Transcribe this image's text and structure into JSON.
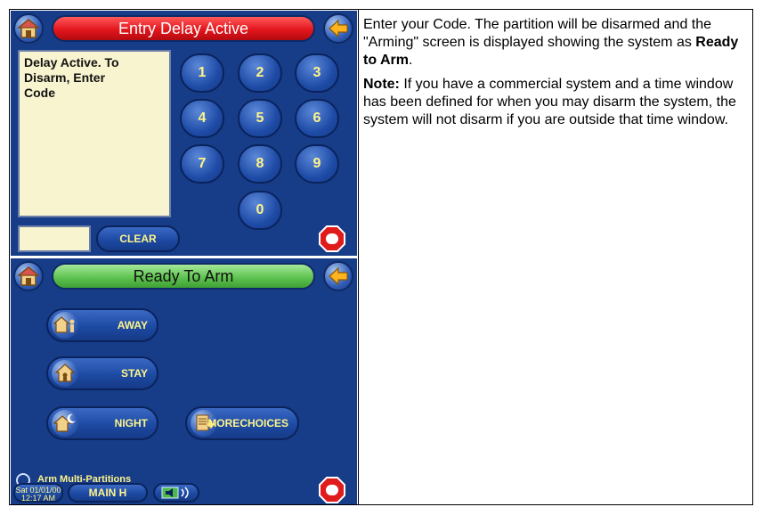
{
  "top_panel": {
    "title": "Entry Delay Active",
    "message": "Delay Active. To\nDisarm, Enter\nCode",
    "keys": [
      "1",
      "2",
      "3",
      "4",
      "5",
      "6",
      "7",
      "8",
      "9",
      "0"
    ],
    "clear_label": "CLEAR"
  },
  "bottom_panel": {
    "title": "Ready To Arm",
    "away_label": "AWAY",
    "stay_label": "STAY",
    "night_label": "NIGHT",
    "more_label_1": "MORE",
    "more_label_2": "CHOICES",
    "multi_partitions_label": "Arm Multi-Partitions",
    "date_line_1": "Sat 01/01/00",
    "date_line_2": "12:17 AM",
    "main_label": "MAIN H"
  },
  "text": {
    "p1_a": "Enter your Code. The partition will be disarmed and the \"Arming\" screen is displayed showing the system as ",
    "p1_b": "Ready to Arm",
    "p1_c": ".",
    "note_label": "Note:",
    "note_body": " If you have a commercial system and a time window has been defined for when you may disarm the system, the system will not disarm if you are outside that time window."
  },
  "colors": {
    "panel_bg": "#173c88",
    "title_red": "#e3161d",
    "title_green": "#5fc451",
    "key_text": "#fff58a"
  }
}
